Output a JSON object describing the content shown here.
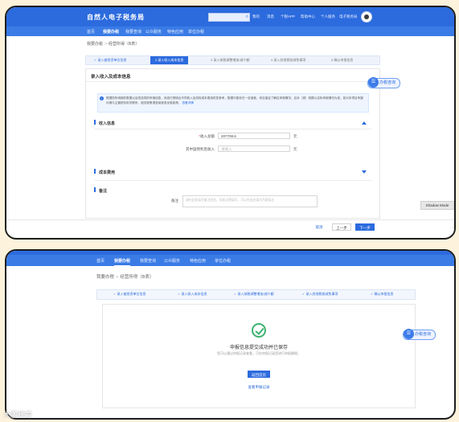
{
  "frame1": {
    "brand": "自然人电子税务局",
    "top_links": [
      "我的",
      "消息",
      "个税APP",
      "帮助中心",
      "个人服务",
      "电子税务局"
    ],
    "nav": [
      "首页",
      "我要办税",
      "我要查询",
      "公众服务",
      "特色应用",
      "单位办税"
    ],
    "nav_active": 1,
    "breadcrumb": [
      "我要办税",
      "经营所得（B表）"
    ],
    "steps": [
      "✓ 录入被投资单位信息",
      "2 录入收入成本信息",
      "3 录入纳税调整增加/减少额",
      "4 录入其他税前减免事项",
      "5 确认申报信息"
    ],
    "section_title": "录入收入及成本信息",
    "notice_text": "根据您所填报的数据以及您选择的申报信息，系统已预填出不同收入及扣除成本费用供您参考，数据可能存在一定误差，你应保证了解应申报情况，应补（退）税额以实际申报情况为准，如对本项目有疑问请与主管税务机关联系，相关政策请查阅税收优惠政策。",
    "notice_link": "查看详情",
    "income_group": "收入信息",
    "income_label": "收入总额",
    "income_value": "207708.6",
    "income_unit": "元",
    "nontax_label": "其中国债利息收入",
    "nontax_placeholder": "请输入",
    "nontax_unit": "元",
    "cost_group": "成本费用",
    "remark_group": "备注",
    "remark_label": "备注",
    "remark_placeholder": "请在此处填写备注信息，如若无需填写，可以在此处填写内容标注",
    "btn_cancel": "取消",
    "btn_prev": "上一步",
    "btn_next": "下一步",
    "consult_label": "办税咨询",
    "shadow_mode": "Shadow Mode"
  },
  "frame2": {
    "nav": [
      "首页",
      "我要办税",
      "我要查询",
      "公众服务",
      "特色应用",
      "单位办税"
    ],
    "nav_active": 1,
    "breadcrumb": [
      "我要办税",
      "经营所得（B表）"
    ],
    "steps": [
      "✓ 录入被投资单位信息",
      "✓ 录入收入成本信息",
      "✓ 录入纳税调整增加/减少额",
      "✓ 录入其他税前减免事项",
      "✓ 确认申报信息"
    ],
    "success_title": "申报信息提交成功并已保存",
    "success_desc": "您可以通过申报记录查看，可在申报记录里进行申报缴税。",
    "btn_back": "返回首页",
    "btn_records": "查看申报记录",
    "consult_label": "办税咨询"
  },
  "watermark": "大鹏税筹",
  "colors": {
    "primary": "#2c6bde",
    "nav": "#3a7be6",
    "success": "#3cb371",
    "background": "#fdf3dc"
  }
}
